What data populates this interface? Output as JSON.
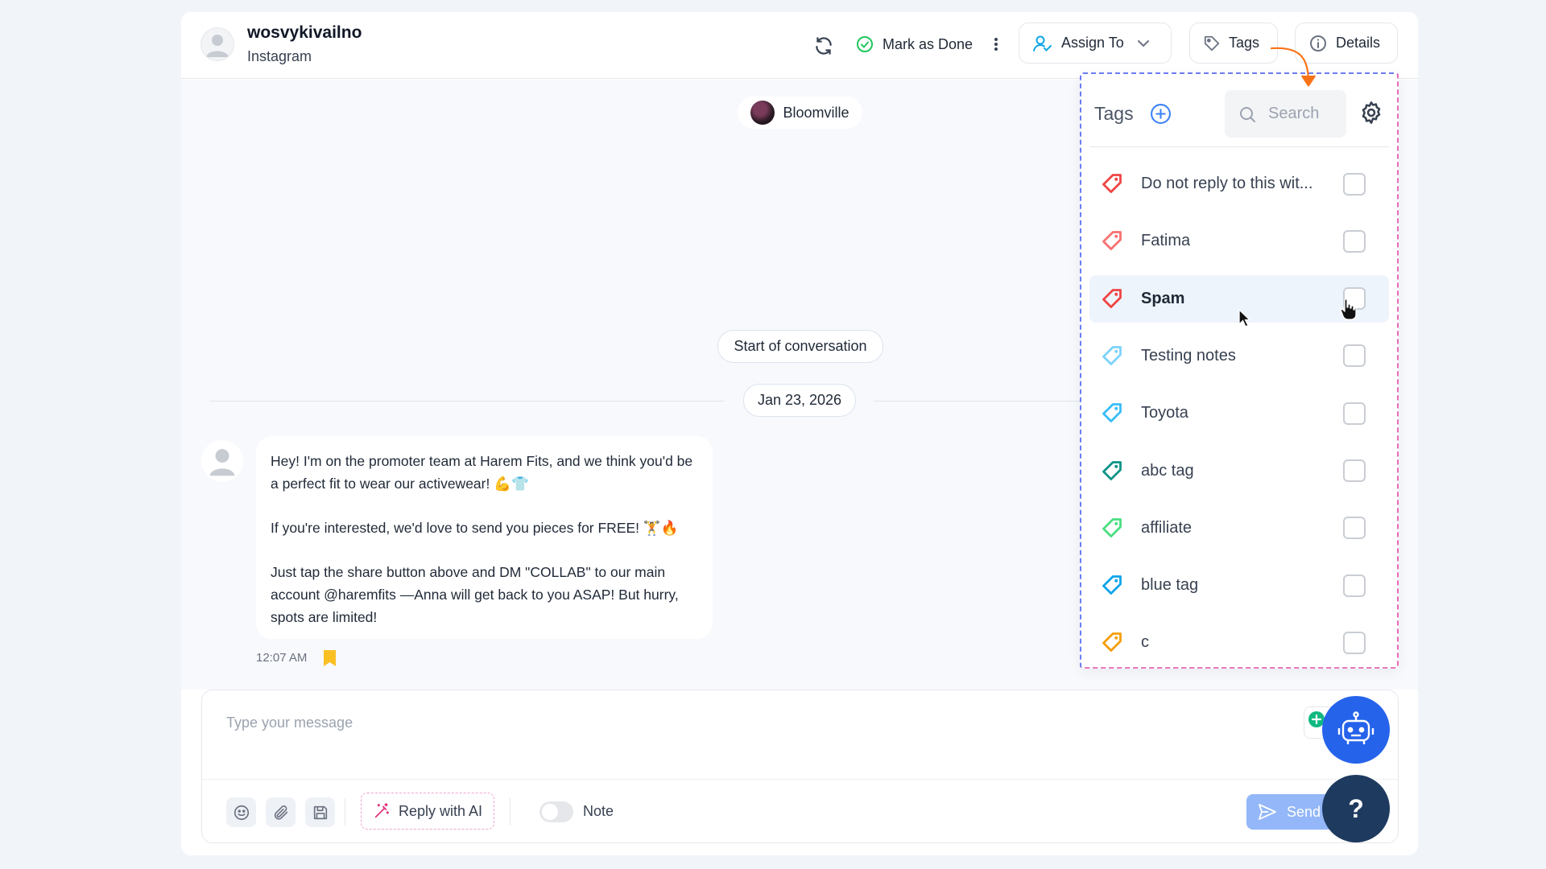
{
  "header": {
    "contact_name": "wosvykivailno",
    "channel": "Instagram",
    "mark_done_label": "Mark as Done",
    "assign_to_label": "Assign To",
    "tags_label": "Tags",
    "details_label": "Details"
  },
  "chat": {
    "page_name": "Bloomville",
    "start_label": "Start of conversation",
    "date_label": "Jan 23, 2026",
    "message": {
      "line1": "Hey! I'm on the promoter team at Harem Fits, and we think you'd be a perfect fit to wear our activewear! 💪👕",
      "line2": "If you're interested, we'd love to send you  pieces for FREE! 🏋️🔥",
      "line3": "Just tap the share button above and DM \"COLLAB\" to our main account @haremfits —Anna will get back to you ASAP! But hurry, spots are limited!",
      "time": "12:07 AM"
    }
  },
  "composer": {
    "placeholder": "Type your message",
    "reply_ai_label": "Reply with AI",
    "note_label": "Note",
    "send_label": "Send"
  },
  "fab": {
    "help_label": "?"
  },
  "tags_panel": {
    "title": "Tags",
    "search_placeholder": "Search",
    "items": [
      {
        "label": "Do not reply to this wit...",
        "color": "#ef4444"
      },
      {
        "label": "Fatima",
        "color": "#f87171"
      },
      {
        "label": "Spam",
        "color": "#ef4444"
      },
      {
        "label": "Testing notes",
        "color": "#7dd3fc"
      },
      {
        "label": "Toyota",
        "color": "#38bdf8"
      },
      {
        "label": "abc tag",
        "color": "#0d9488"
      },
      {
        "label": "affiliate",
        "color": "#4ade80"
      },
      {
        "label": "blue tag",
        "color": "#0ea5e9"
      },
      {
        "label": "c",
        "color": "#f59e0b"
      }
    ]
  },
  "colors": {
    "accent_blue": "#2563eb",
    "done_green": "#22c55e",
    "fab_blue": "#2563eb",
    "fab_dark": "#1e3a5f",
    "bookmark": "#fbbf24"
  }
}
